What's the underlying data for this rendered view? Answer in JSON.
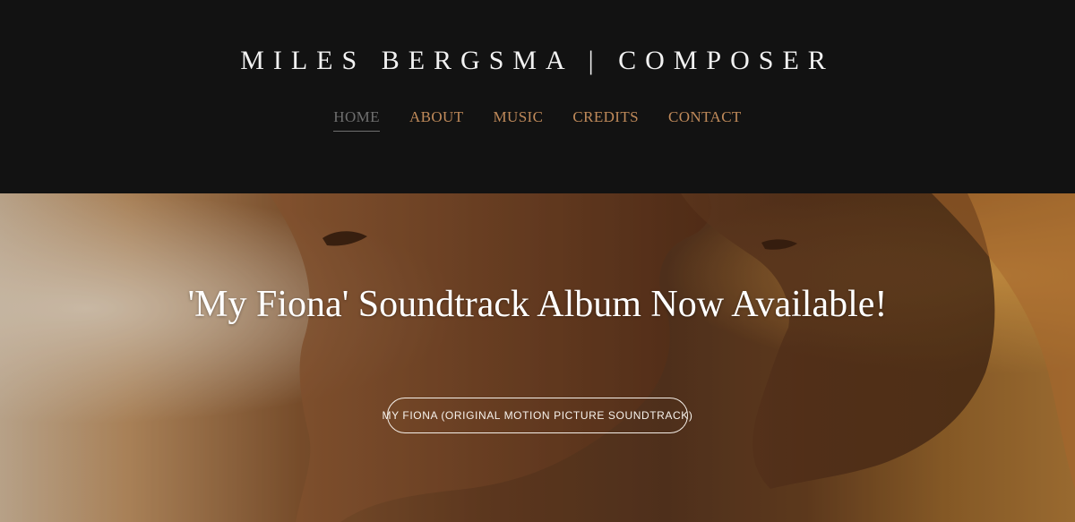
{
  "header": {
    "site_title": "MILES BERGSMA | COMPOSER"
  },
  "nav": {
    "items": [
      {
        "label": "HOME",
        "active": true
      },
      {
        "label": "ABOUT",
        "active": false
      },
      {
        "label": "MUSIC",
        "active": false
      },
      {
        "label": "CREDITS",
        "active": false
      },
      {
        "label": "CONTACT",
        "active": false
      }
    ],
    "colors": {
      "link": "#c08a5a",
      "active": "#6f6f6f"
    }
  },
  "hero": {
    "heading": "'My Fiona' Soundtrack Album Now Available!",
    "button_label": "MY FIONA (ORIGINAL MOTION PICTURE SOUNDTRACK)"
  },
  "colors": {
    "header_bg": "#121212",
    "title_text": "#f2f2f2",
    "hero_text": "#ffffff"
  }
}
